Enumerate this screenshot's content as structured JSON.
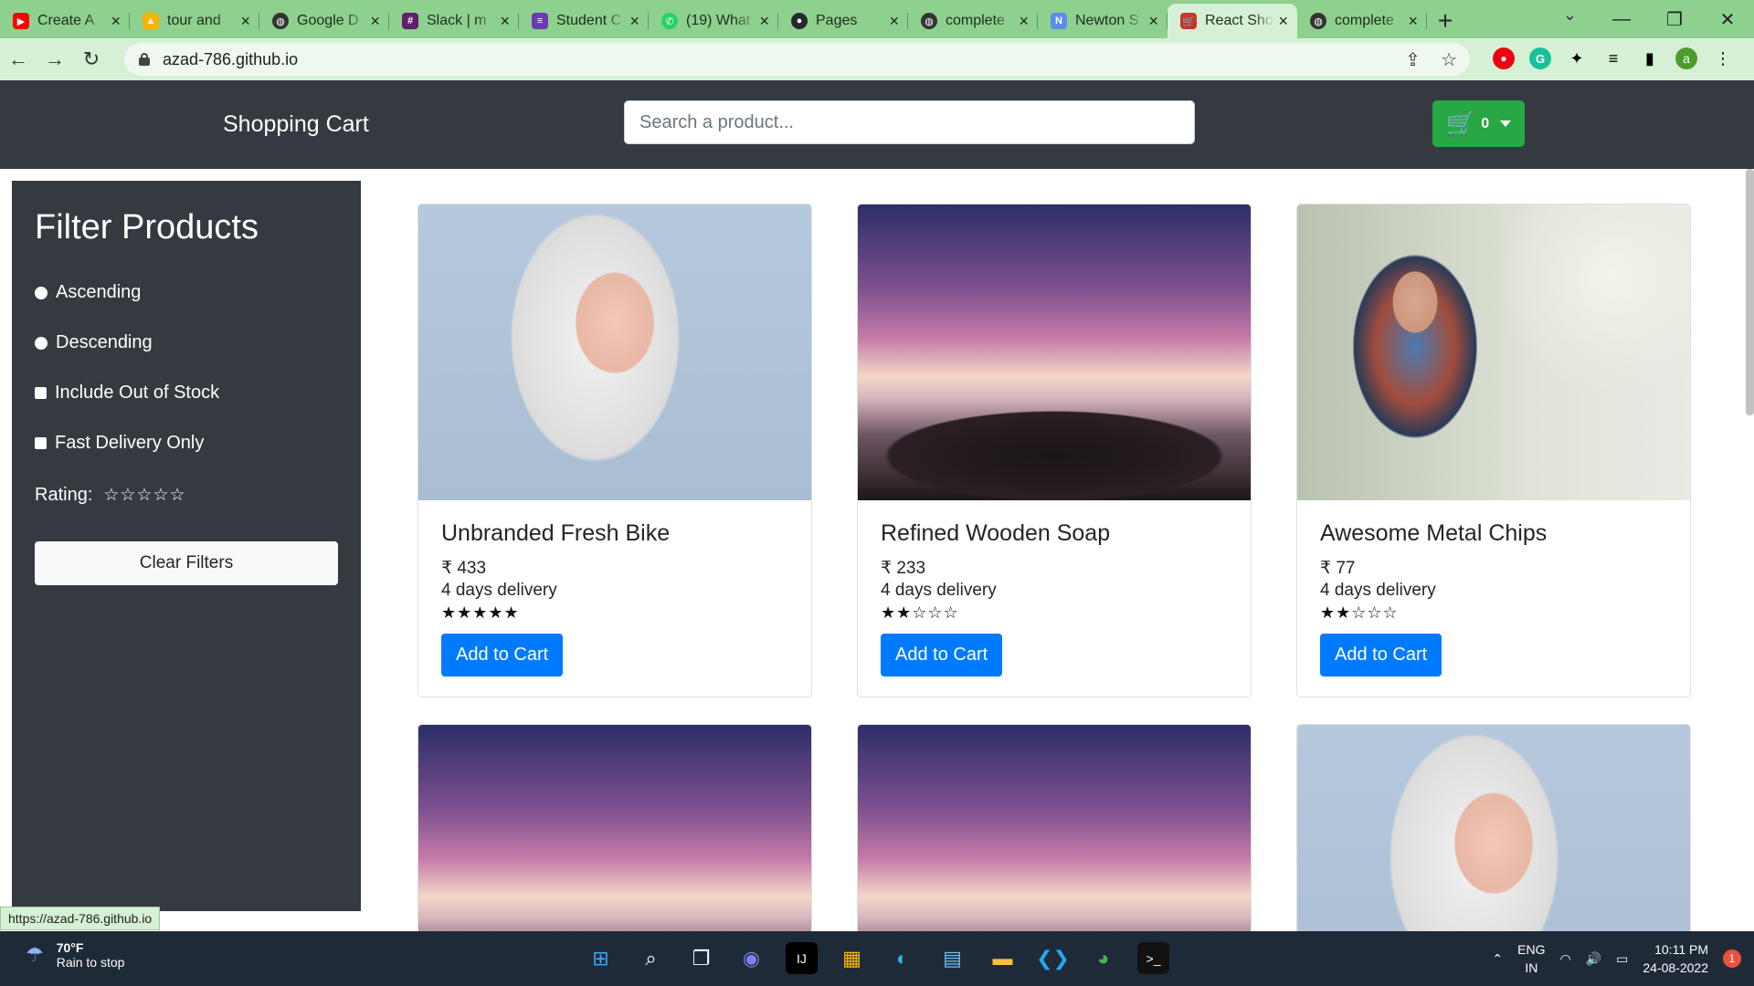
{
  "browser": {
    "tabs": [
      {
        "title": "Create A",
        "favicon": "youtube-icon",
        "color": "#ff0000"
      },
      {
        "title": "tour and",
        "favicon": "drive-icon",
        "color": "#f4b400"
      },
      {
        "title": "Google D",
        "favicon": "globe-icon",
        "color": "#333333"
      },
      {
        "title": "Slack | m",
        "favicon": "slack-icon",
        "color": "#611f69"
      },
      {
        "title": "Student C",
        "favicon": "forms-icon",
        "color": "#673ab7"
      },
      {
        "title": "(19) What",
        "favicon": "whatsapp-icon",
        "color": "#25d366"
      },
      {
        "title": "Pages",
        "favicon": "github-icon",
        "color": "#24292e"
      },
      {
        "title": "complete",
        "favicon": "globe-icon",
        "color": "#333333"
      },
      {
        "title": "Newton S",
        "favicon": "newton-icon",
        "color": "#5b8def"
      },
      {
        "title": "React Sho",
        "favicon": "cart-icon",
        "color": "#c0392b",
        "active": true
      },
      {
        "title": "complete",
        "favicon": "globe-icon",
        "color": "#333333"
      }
    ],
    "url": "azad-786.github.io",
    "status_url": "https://azad-786.github.io",
    "profile_initial": "a"
  },
  "app": {
    "brand": "Shopping Cart",
    "search_placeholder": "Search a product...",
    "cart_count": "0",
    "accent": "#28a745"
  },
  "filters": {
    "title": "Filter Products",
    "ascending": "Ascending",
    "descending": "Descending",
    "out_of_stock": "Include Out of Stock",
    "fast_delivery": "Fast Delivery Only",
    "rating_label": "Rating:",
    "rating_stars": "☆☆☆☆☆",
    "clear_label": "Clear Filters"
  },
  "products": [
    {
      "name": "Unbranded Fresh Bike",
      "price": "₹ 433",
      "delivery": "4 days delivery",
      "stars": "★★★★★",
      "rating": 5,
      "button": "Add to Cart",
      "image": "woman-portrait"
    },
    {
      "name": "Refined Wooden Soap",
      "price": "₹ 233",
      "delivery": "4 days delivery",
      "stars": "★★☆☆☆",
      "rating": 2,
      "button": "Add to Cart",
      "image": "sunset-sea"
    },
    {
      "name": "Awesome Metal Chips",
      "price": "₹ 77",
      "delivery": "4 days delivery",
      "stars": "★★☆☆☆",
      "rating": 2,
      "button": "Add to Cart",
      "image": "hooded-woman"
    }
  ],
  "taskbar": {
    "temperature": "70°F",
    "weather": "Rain to stop",
    "lang1": "ENG",
    "lang2": "IN",
    "time": "10:11 PM",
    "date": "24-08-2022",
    "notifications": "1"
  }
}
